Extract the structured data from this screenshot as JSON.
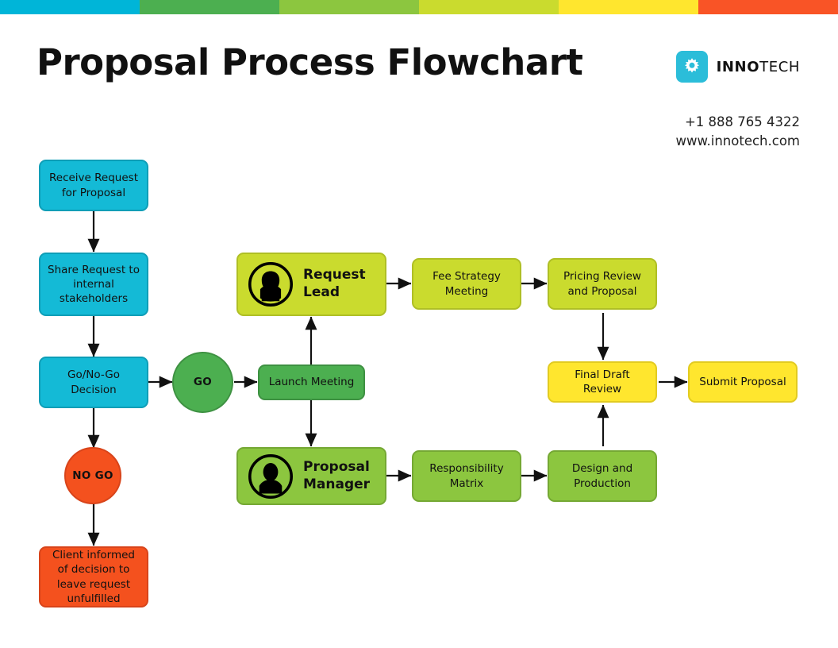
{
  "header": {
    "title": "Proposal Process Flowchart",
    "brand_bold": "INNO",
    "brand_light": "TECH",
    "brand_icon": "gear-icon",
    "brand_mark_color": "#2BBDD9",
    "phone": "+1 888 765 4322",
    "website": "www.innotech.com"
  },
  "top_bar": {
    "colors": [
      "#00B5D8",
      "#4CAF50",
      "#8CC63F",
      "#CADB2E",
      "#FFE62E",
      "#F95426"
    ]
  },
  "palette": {
    "cyan_fill": "#14BAD6",
    "cyan_border": "#0E9EB7",
    "orange_fill": "#F4511E",
    "orange_border": "#D8441A",
    "green_fill": "#4CAF50",
    "green_border": "#3E9142",
    "lime_fill": "#8CC63F",
    "lime_border": "#75A834",
    "yellowgreen_fill": "#CADB2E",
    "yellowgreen_border": "#AFBF25",
    "yellow_fill": "#FFE62E",
    "yellow_border": "#E2CB20",
    "edge_color": "#111111"
  },
  "nodes": {
    "receive_request": "Receive Request for Proposal",
    "share_request": "Share Request to internal stakeholders",
    "go_no_go": "Go/No-Go Decision",
    "go": "GO",
    "no_go": "NO GO",
    "client_informed": "Client informed of decision to leave request unfulfilled",
    "launch_meeting": "Launch Meeting",
    "request_lead": "Request Lead",
    "proposal_manager": "Proposal Manager",
    "fee_strategy": "Fee Strategy Meeting",
    "pricing_review": "Pricing Review and Proposal",
    "responsibility_matrix": "Responsibility Matrix",
    "design_production": "Design and Production",
    "final_draft_review": "Final Draft Review",
    "submit_proposal": "Submit Proposal"
  },
  "icons": {
    "request_lead_avatar": "user-female-avatar-icon",
    "proposal_manager_avatar": "user-male-avatar-icon"
  }
}
